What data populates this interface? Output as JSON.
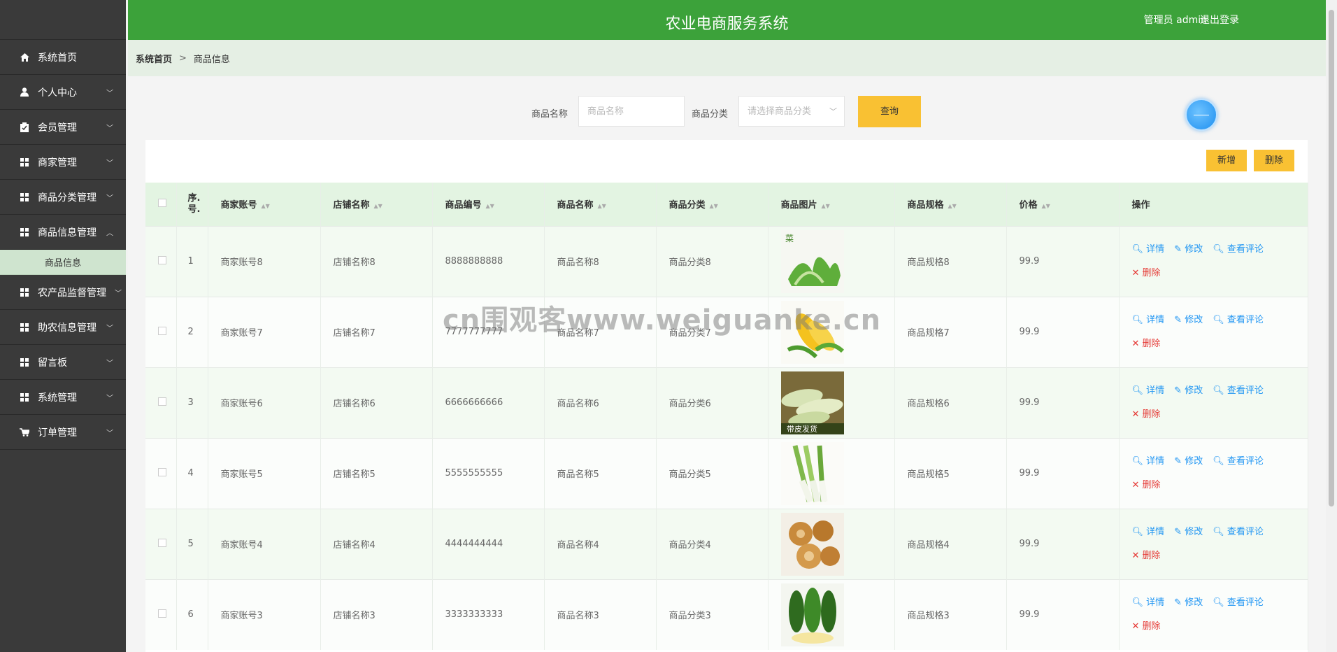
{
  "app": {
    "title": "农业电商服务系统"
  },
  "header": {
    "user": "管理员 admin",
    "logout": "退出登录"
  },
  "sidebar": {
    "items": [
      {
        "label": "系统首页",
        "icon": "home-icon",
        "expandable": false
      },
      {
        "label": "个人中心",
        "icon": "user-icon",
        "expandable": true
      },
      {
        "label": "会员管理",
        "icon": "clipboard-icon",
        "expandable": true
      },
      {
        "label": "商家管理",
        "icon": "grid-icon",
        "expandable": true
      },
      {
        "label": "商品分类管理",
        "icon": "grid-icon",
        "expandable": true
      },
      {
        "label": "商品信息管理",
        "icon": "grid-icon",
        "expandable": true,
        "expanded": true
      },
      {
        "label": "农产品监督管理",
        "icon": "grid-icon",
        "expandable": true
      },
      {
        "label": "助农信息管理",
        "icon": "grid-icon",
        "expandable": true
      },
      {
        "label": "留言板",
        "icon": "grid-icon",
        "expandable": true
      },
      {
        "label": "系统管理",
        "icon": "grid-icon",
        "expandable": true
      },
      {
        "label": "订单管理",
        "icon": "cart-icon",
        "expandable": true
      }
    ],
    "sub_item": "商品信息"
  },
  "breadcrumb": {
    "home": "系统首页",
    "sep": ">",
    "current": "商品信息"
  },
  "search": {
    "name_label": "商品名称",
    "name_placeholder": "商品名称",
    "category_label": "商品分类",
    "category_placeholder": "请选择商品分类",
    "query_button": "查询"
  },
  "toolbar": {
    "add": "新增",
    "delete": "删除"
  },
  "table": {
    "headers": [
      "序号",
      "商家账号",
      "店铺名称",
      "商品编号",
      "商品名称",
      "商品分类",
      "商品图片",
      "商品规格",
      "价格",
      "操作"
    ],
    "index_header_line1": "序.",
    "index_header_line2": "号.",
    "rows": [
      {
        "idx": "1",
        "account": "商家账号8",
        "shop": "店铺名称8",
        "code": "8888888888",
        "name": "商品名称8",
        "category": "商品分类8",
        "image": "leafy-greens",
        "spec": "商品规格8",
        "price": "99.9",
        "img_text": "菜"
      },
      {
        "idx": "2",
        "account": "商家账号7",
        "shop": "店铺名称7",
        "code": "7777777777",
        "name": "商品名称7",
        "category": "商品分类7",
        "image": "corn",
        "spec": "商品规格7",
        "price": "99.9",
        "img_text": ""
      },
      {
        "idx": "3",
        "account": "商家账号6",
        "shop": "店铺名称6",
        "code": "6666666666",
        "name": "商品名称6",
        "category": "商品分类6",
        "image": "corn-husk",
        "spec": "商品规格6",
        "price": "99.9",
        "img_text": "带皮发货"
      },
      {
        "idx": "4",
        "account": "商家账号5",
        "shop": "店铺名称5",
        "code": "5555555555",
        "name": "商品名称5",
        "category": "商品分类5",
        "image": "scallion",
        "spec": "商品规格5",
        "price": "99.9",
        "img_text": ""
      },
      {
        "idx": "5",
        "account": "商家账号4",
        "shop": "店铺名称4",
        "code": "4444444444",
        "name": "商品名称4",
        "category": "商品分类4",
        "image": "dried-figs",
        "spec": "商品规格4",
        "price": "99.9",
        "img_text": ""
      },
      {
        "idx": "6",
        "account": "商家账号3",
        "shop": "店铺名称3",
        "code": "3333333333",
        "name": "商品名称3",
        "category": "商品分类3",
        "image": "corn-green",
        "spec": "商品规格3",
        "price": "99.9",
        "img_text": ""
      }
    ],
    "actions": {
      "detail": "详情",
      "edit": "修改",
      "review": "查看评论",
      "delete": "删除"
    }
  },
  "watermark": "cn围观客www.weiguanke.cn",
  "colors": {
    "header": "#3ca23a",
    "sidebar": "#3a3a3a",
    "accent_button": "#f9c133",
    "link": "#2196f3",
    "danger": "#e53935"
  }
}
